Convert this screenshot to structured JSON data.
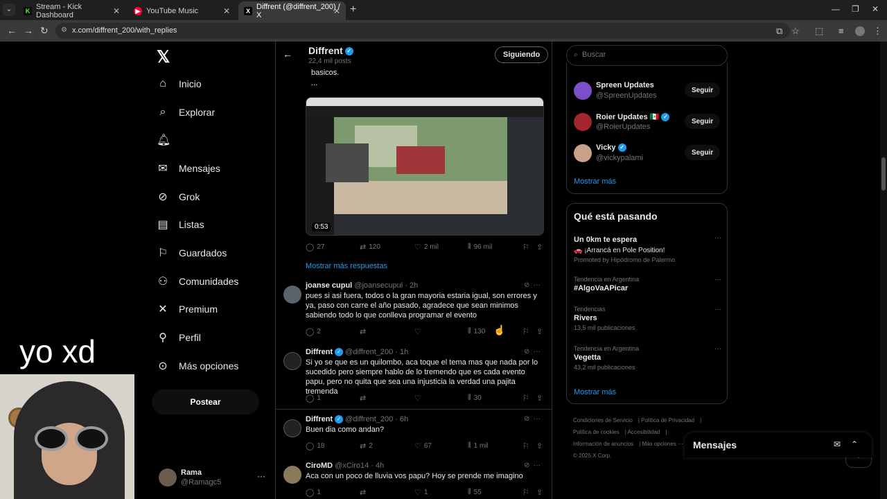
{
  "browser": {
    "tabs": [
      {
        "title": "Stream - Kick Dashboard",
        "fav": "K",
        "fav_color": "#53fc18"
      },
      {
        "title": "YouTube Music",
        "fav": "▶",
        "fav_color": "#ff0033"
      },
      {
        "title": "Diffrent (@diffrent_200) / X",
        "fav": "X",
        "fav_color": "#000000"
      }
    ],
    "url": "x.com/diffrent_200/with_replies"
  },
  "nav": {
    "items": [
      {
        "label": "Inicio",
        "icon": "home-icon"
      },
      {
        "label": "Explorar",
        "icon": "search-icon"
      },
      {
        "label": "",
        "icon": "bell-icon"
      },
      {
        "label": "Mensajes",
        "icon": "mail-icon"
      },
      {
        "label": "Grok",
        "icon": "grok-icon"
      },
      {
        "label": "Listas",
        "icon": "list-icon"
      },
      {
        "label": "Guardados",
        "icon": "bookmark-icon"
      },
      {
        "label": "Comunidades",
        "icon": "people-icon"
      },
      {
        "label": "Premium",
        "icon": "x-icon"
      },
      {
        "label": "Perfil",
        "icon": "person-icon"
      },
      {
        "label": "Más opciones",
        "icon": "more-icon"
      }
    ],
    "post_label": "Postear",
    "user_name": "Rama",
    "user_handle": "@Ramagc5"
  },
  "overlay_text": "yo xd",
  "profile": {
    "name": "Diffrent",
    "posts_count": "22,4 mil posts",
    "follow_label": "Siguiendo"
  },
  "tweet": {
    "fragment_1": "basicos.",
    "fragment_2": "...",
    "video_duration": "0:53",
    "stats": {
      "replies": "27",
      "reposts": "120",
      "likes": "2 mil",
      "views": "96 mil"
    }
  },
  "more_replies": "Mostrar más respuestas",
  "replies": [
    {
      "name": "joanse cupul",
      "handle": "@joansecupul",
      "time": "· 2h",
      "verified": false,
      "text": "pues si asi fuera, todos o la gran mayoria estaria igual, son errores y ya, paso con carre el año pasado, agradece que sean minimos sabiendo todo lo que conlleva programar el evento",
      "replies": "2",
      "reposts": "",
      "likes": "",
      "views": "130"
    },
    {
      "name": "Diffrent",
      "handle": "@diffrent_200",
      "time": "· 1h",
      "verified": true,
      "text": "Si yo se que es un quilombo, aca toque el tema mas que nada por lo sucedido pero siempre hablo de lo tremendo que es cada evento papu, pero no quita que sea una injusticia la verdad una pajita tremenda",
      "replies": "1",
      "reposts": "",
      "likes": "",
      "views": "30"
    },
    {
      "name": "Diffrent",
      "handle": "@diffrent_200",
      "time": "· 6h",
      "verified": true,
      "text": "Buen dia como andan?",
      "replies": "18",
      "reposts": "2",
      "likes": "67",
      "views": "1 mil"
    },
    {
      "name": "CiroMD",
      "handle": "@xCiro14",
      "time": "· 4h",
      "verified": false,
      "text": "Aca con un poco de lluvia vos papu? Hoy se prende me imagino",
      "replies": "1",
      "reposts": "",
      "likes": "1",
      "views": "55"
    }
  ],
  "right": {
    "search_placeholder": "Buscar",
    "who_to_follow": [
      {
        "name": "Spreen Updates",
        "handle": "@SpreenUpdates",
        "button": "Seguir",
        "color": "#7b4fc9"
      },
      {
        "name": "Roier Updates 🇲🇽",
        "handle": "@RoierUpdates",
        "button": "Seguir",
        "color": "#a3262c"
      },
      {
        "name": "Vicky",
        "handle": "@vickypalami",
        "button": "Seguir",
        "color": "#c9a08a"
      }
    ],
    "show_more": "Mostrar más",
    "trends_title": "Qué está pasando",
    "trends": [
      {
        "context": "",
        "name": "Un 0km te espera",
        "sub": "🚗 ¡Arrancá en Pole Position!",
        "extra": "Promoted by Hipódromo de Palermo"
      },
      {
        "context": "Tendencia en Argentina",
        "name": "#AlgoVaAPicar",
        "sub": "",
        "extra": ""
      },
      {
        "context": "Tendencias",
        "name": "Rivers",
        "sub": "13,5 mil publicaciones",
        "extra": ""
      },
      {
        "context": "Tendencia en Argentina",
        "name": "Vegetta",
        "sub": "43,2 mil publicaciones",
        "extra": ""
      }
    ],
    "trends_show_more": "Mostrar más",
    "footer": [
      "Condiciones de Servicio",
      "Política de Privacidad",
      "Política de cookies",
      "Accesibilidad",
      "Información de anuncios",
      "Más opciones ···",
      "© 2025 X Corp."
    ]
  },
  "messages_dock": "Mensajes"
}
